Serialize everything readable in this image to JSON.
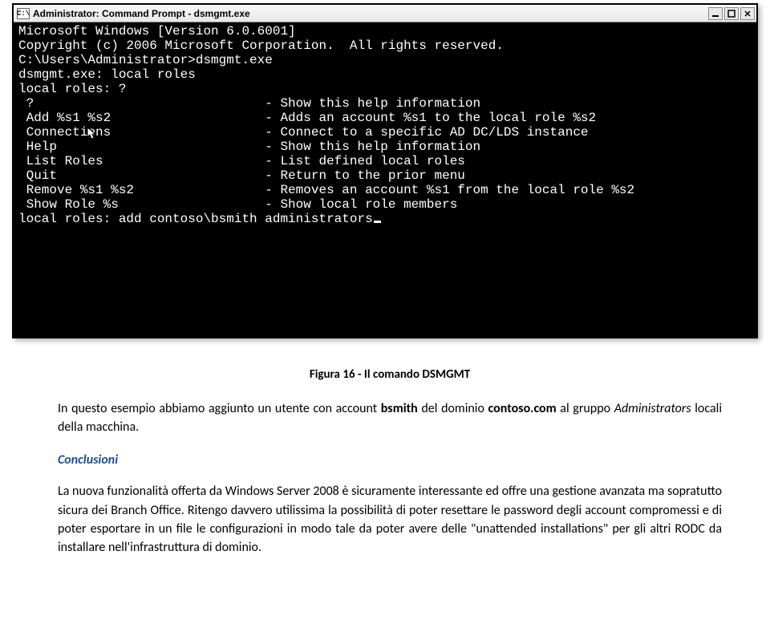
{
  "cmd_window": {
    "icon_text": "C:\\",
    "title": "Administrator: Command Prompt - dsmgmt.exe",
    "lines": [
      "Microsoft Windows [Version 6.0.6001]",
      "Copyright (c) 2006 Microsoft Corporation.  All rights reserved.",
      "",
      "C:\\Users\\Administrator>dsmgmt.exe",
      "dsmgmt.exe: local roles",
      "local roles: ?",
      "",
      " ?                              - Show this help information",
      " Add %s1 %s2                    - Adds an account %s1 to the local role %s2",
      " Connections                    - Connect to a specific AD DC/LDS instance",
      " Help                           - Show this help information",
      " List Roles                     - List defined local roles",
      " Quit                           - Return to the prior menu",
      " Remove %s1 %s2                 - Removes an account %s1 from the local role %s2",
      " Show Role %s                   - Show local role members",
      "",
      "local roles: add contoso\\bsmith administrators"
    ],
    "cursor_overlay_line_index": 9
  },
  "caption": "Figura 16 - Il comando DSMGMT",
  "para1_prefix": "In questo esempio abbiamo aggiunto un utente con account ",
  "para1_bold1": "bsmith",
  "para1_mid": " del dominio ",
  "para1_bold2": "contoso.com",
  "para1_after": " al gruppo ",
  "para1_italic": "Administrators",
  "para1_end": " locali della macchina.",
  "section_heading": "Conclusioni",
  "para2": "La nuova funzionalità offerta da Windows Server 2008 è sicuramente interessante ed offre una gestione avanzata ma sopratutto sicura dei Branch Office. Ritengo davvero utilissima la possibilità di poter resettare le password degli account compromessi e di poter esportare in un file le configurazioni in modo tale da poter avere delle \"unattended installations\" per gli altri RODC da installare nell'infrastruttura di dominio."
}
